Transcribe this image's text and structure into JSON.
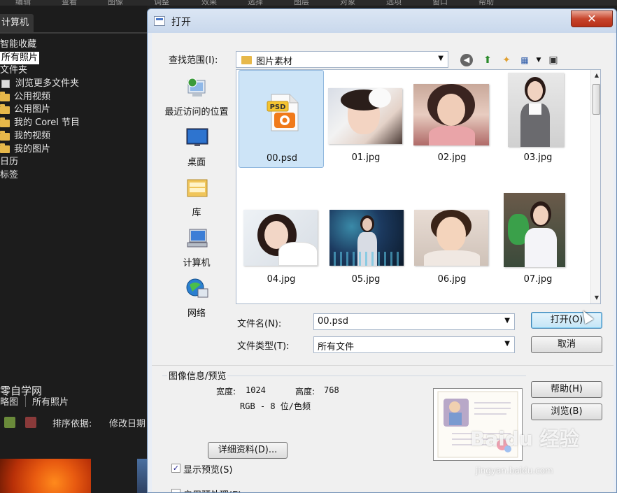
{
  "background_app": {
    "menubar": [
      "编辑",
      "查看",
      "图像",
      "调整",
      "效果",
      "选择",
      "图层",
      "对象",
      "选项",
      "窗口",
      "帮助"
    ],
    "panel_tab": "计算机",
    "tree": [
      {
        "label": "智能收藏",
        "icon": "none",
        "selected": false
      },
      {
        "label": "所有照片",
        "icon": "none",
        "selected": true
      },
      {
        "label": "文件夹",
        "icon": "none",
        "selected": false
      },
      {
        "label": "浏览更多文件夹",
        "icon": "browse-icon",
        "selected": false
      },
      {
        "label": "公用视频",
        "icon": "folder-icon",
        "selected": false
      },
      {
        "label": "公用图片",
        "icon": "folder-icon",
        "selected": false
      },
      {
        "label": "我的 Corel 节目",
        "icon": "folder-icon",
        "selected": false
      },
      {
        "label": "我的视频",
        "icon": "folder-icon",
        "selected": false
      },
      {
        "label": "我的图片",
        "icon": "folder-icon",
        "selected": false
      },
      {
        "label": "日历",
        "icon": "none",
        "selected": false
      },
      {
        "label": "标签",
        "icon": "none",
        "selected": false
      }
    ],
    "brand_text": "零自学网",
    "view_tabs": [
      "略图",
      "所有照片"
    ],
    "sort_label": "排序依据:",
    "sort_value": "修改日期"
  },
  "dialog": {
    "title": "打开",
    "close_label": "✕",
    "look_in_label": "查找范围(I):",
    "look_in_value": "图片素材",
    "places": [
      {
        "label": "最近访问的位置",
        "icon": "recent-places-icon"
      },
      {
        "label": "桌面",
        "icon": "desktop-icon"
      },
      {
        "label": "库",
        "icon": "libraries-icon"
      },
      {
        "label": "计算机",
        "icon": "computer-icon"
      },
      {
        "label": "网络",
        "icon": "network-icon"
      }
    ],
    "files": [
      {
        "name": "00.psd",
        "type": "psd",
        "selected": true,
        "badge": "PSD"
      },
      {
        "name": "01.jpg",
        "type": "jpg",
        "selected": false
      },
      {
        "name": "02.jpg",
        "type": "jpg",
        "selected": false
      },
      {
        "name": "03.jpg",
        "type": "jpg",
        "selected": false
      },
      {
        "name": "04.jpg",
        "type": "jpg",
        "selected": false
      },
      {
        "name": "05.jpg",
        "type": "jpg",
        "selected": false
      },
      {
        "name": "06.jpg",
        "type": "jpg",
        "selected": false
      },
      {
        "name": "07.jpg",
        "type": "jpg",
        "selected": false
      }
    ],
    "filename_label": "文件名(N):",
    "filename_value": "00.psd",
    "filetype_label": "文件类型(T):",
    "filetype_value": "所有文件",
    "open_label": "打开(O)",
    "cancel_label": "取消",
    "info_title": "图像信息/预览",
    "width_label": "宽度:",
    "width_value": "1024",
    "height_label": "高度:",
    "height_value": "768",
    "mode_text": "RGB - 8 位/色频",
    "details_label": "详细资料(D)...",
    "help_label": "帮助(H)",
    "browse_label": "浏览(B)",
    "show_preview_label": "显示预览(S)",
    "show_preview_checked": true,
    "preprocess_label": "启用预处理(E)",
    "preprocess_checked": false
  },
  "watermark": {
    "main": "Baidu 经验",
    "sub": "jingyan.baidu.com"
  },
  "colors": {
    "dialog_bg": "#f0f0f0",
    "selection": "#cde4f7",
    "close_red": "#c7452c",
    "dark_bg": "#1c1c1c"
  }
}
